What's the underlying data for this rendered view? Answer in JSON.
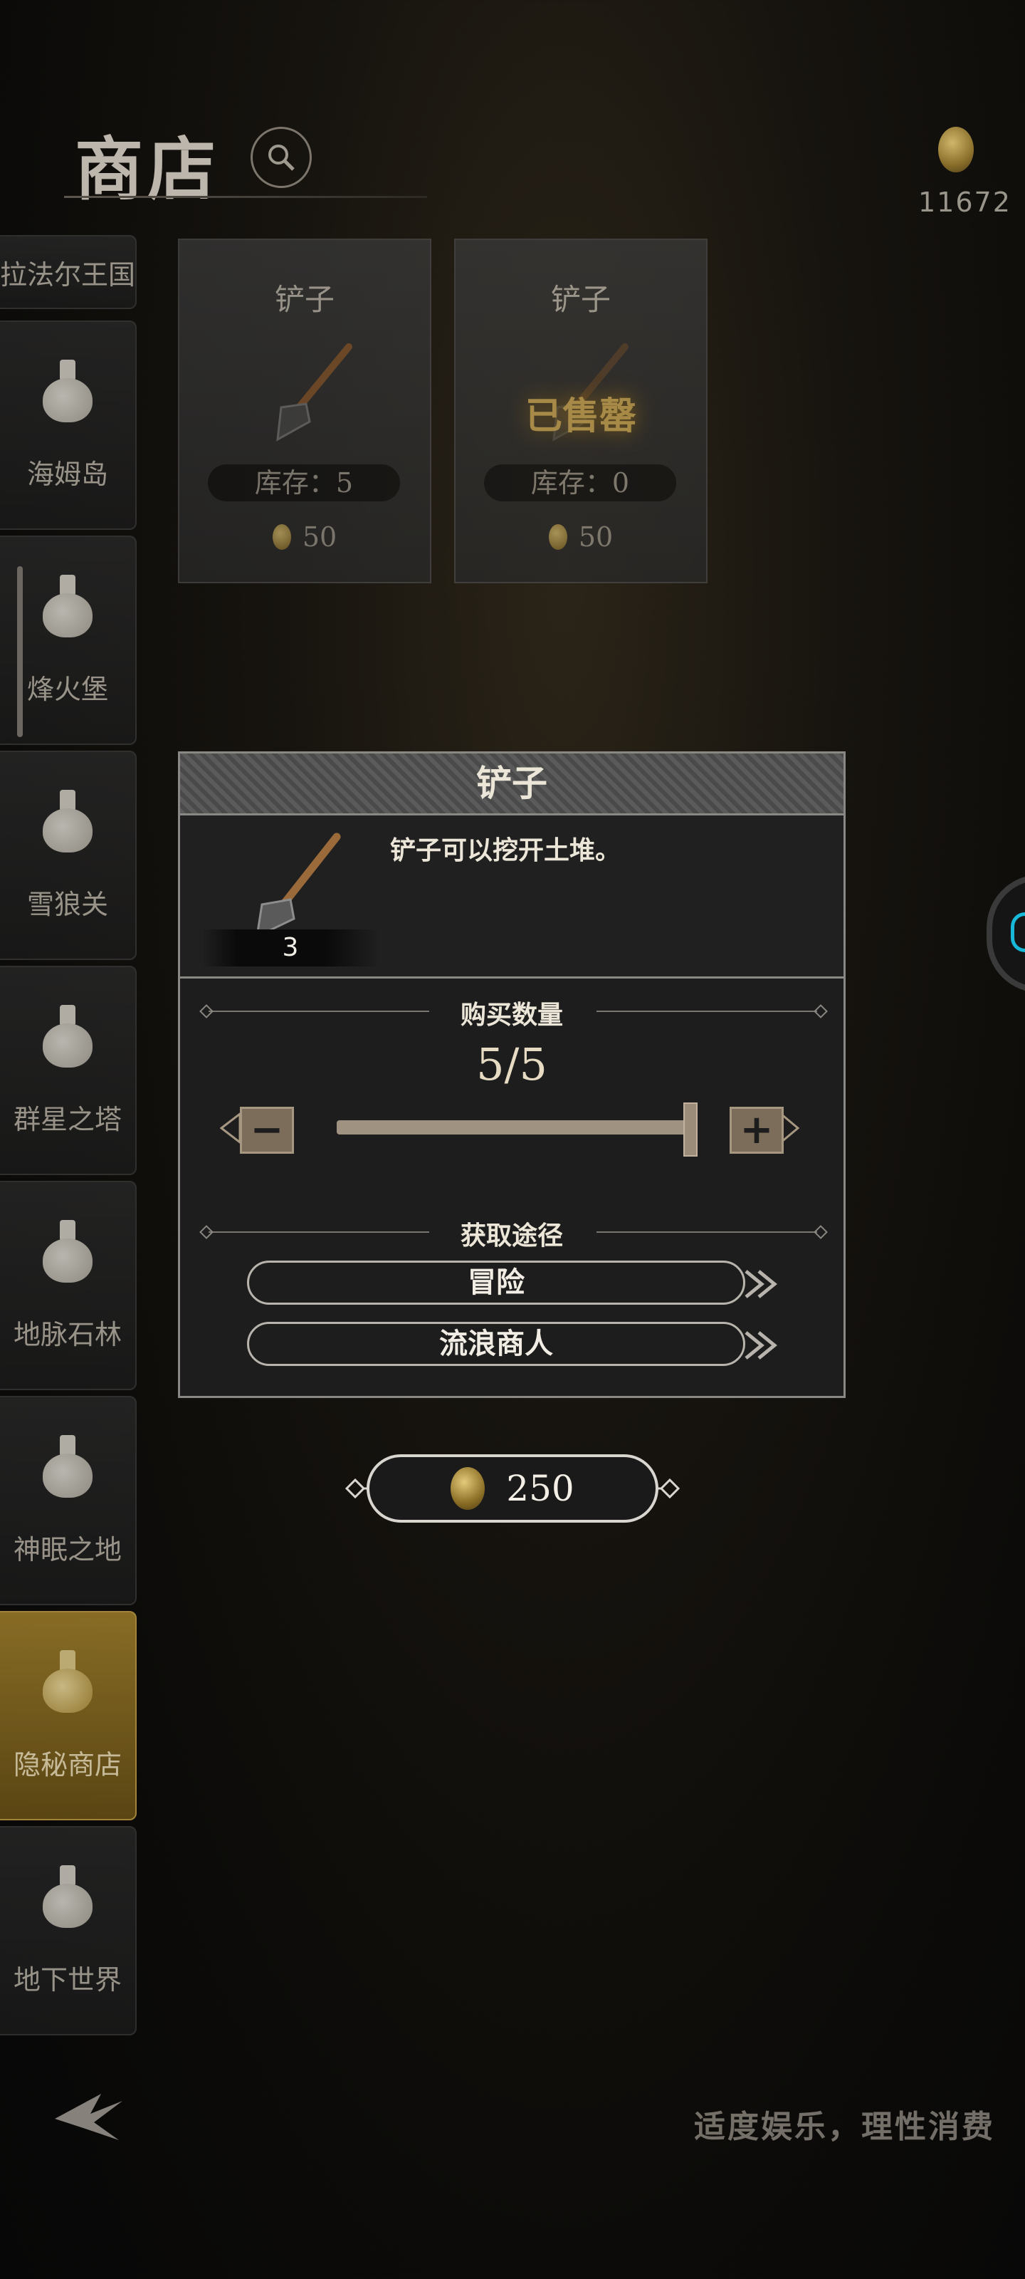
{
  "header": {
    "title": "商店",
    "currency_amount": "11672"
  },
  "sidebar": {
    "items": [
      {
        "label": "拉法尔王国"
      },
      {
        "label": "海姆岛"
      },
      {
        "label": "烽火堡"
      },
      {
        "label": "雪狼关"
      },
      {
        "label": "群星之塔"
      },
      {
        "label": "地脉石林"
      },
      {
        "label": "神眠之地"
      },
      {
        "label": "隐秘商店"
      },
      {
        "label": "地下世界"
      }
    ],
    "active_item": "隐秘商店"
  },
  "shop_items": [
    {
      "name": "铲子",
      "stock": "库存：5",
      "price": "50",
      "sold_out": ""
    },
    {
      "name": "铲子",
      "stock": "库存：0",
      "price": "50",
      "sold_out": "已售罄"
    }
  ],
  "dialog": {
    "title": "铲子",
    "description": "铲子可以挖开土堆。",
    "owned_count": "3",
    "quantity_section_label": "购买数量",
    "quantity_display": "5/5",
    "quantity_selected": 5,
    "quantity_max": 5,
    "minus_label": "−",
    "plus_label": "+",
    "acquire_section_label": "获取途径",
    "acquire_routes": [
      "冒险",
      "流浪商人"
    ]
  },
  "purchase": {
    "total_price": "250"
  },
  "footer": {
    "notice": "适度娱乐，理性消费"
  },
  "icons": {
    "search": "search-icon",
    "coin": "coin-icon",
    "back": "back-icon",
    "shovel": "shovel-icon",
    "potion": "potion-flask-icon"
  }
}
